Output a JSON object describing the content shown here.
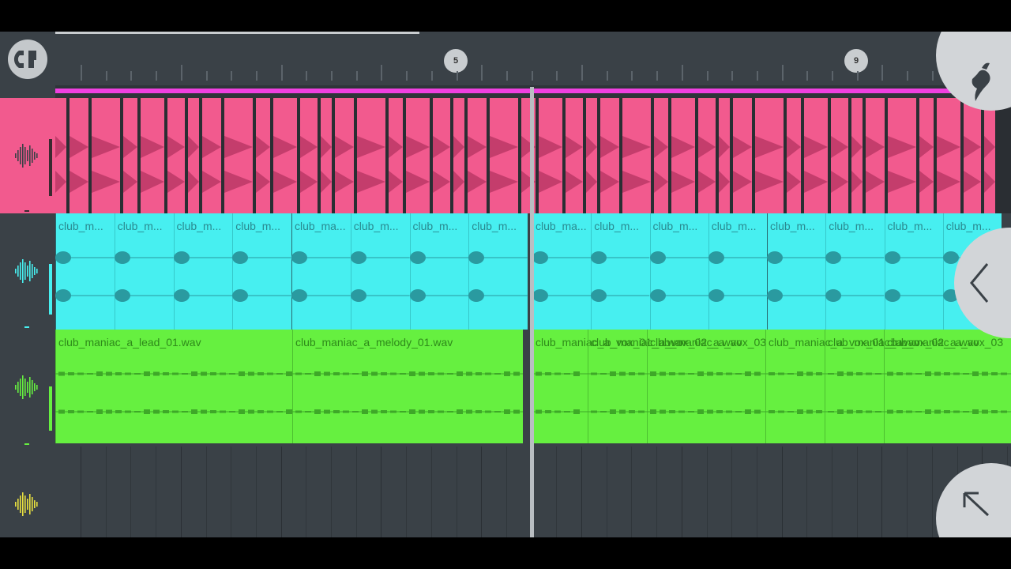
{
  "ruler": {
    "bar_markers": [
      "5",
      "9"
    ]
  },
  "colors": {
    "pink_track": "#f25a8e",
    "cyan_track": "#47eff0",
    "green_track": "#66f040",
    "yellow_icon": "#e8e040",
    "pattern_bar": "#f040e0"
  },
  "icons": {
    "magnet": "magnet-snap-icon",
    "fl_logo": "fl-studio-logo-icon",
    "back": "chevron-left-icon",
    "corner": "arrow-up-left-icon"
  },
  "tracks": [
    {
      "id": "t1",
      "color": "pink",
      "clips": []
    },
    {
      "id": "t2",
      "color": "cyan",
      "clips": [
        "club_m...",
        "club_m...",
        "club_m...",
        "club_m...",
        "club_ma...",
        "club_m...",
        "club_m...",
        "club_m...",
        "club_ma...",
        "club_m...",
        "club_m...",
        "club_m...",
        "club_m...",
        "club_m...",
        "club_m...",
        "club_m..."
      ]
    },
    {
      "id": "t3",
      "color": "green",
      "clips": [
        "club_maniac_a_lead_01.wav",
        "club_maniac_a_melody_01.wav",
        "club_maniac_a_vox_01_b.wav",
        "club_maniac_a_vox_02_a.wav",
        "club_maniac_a_vox_03",
        "club_maniac_a_vox_01_b.wav",
        "club_maniac_a_vox_02_a.wav",
        "club_maniac_a_vox_03"
      ]
    },
    {
      "id": "t4",
      "color": "yellow",
      "clips": []
    }
  ]
}
